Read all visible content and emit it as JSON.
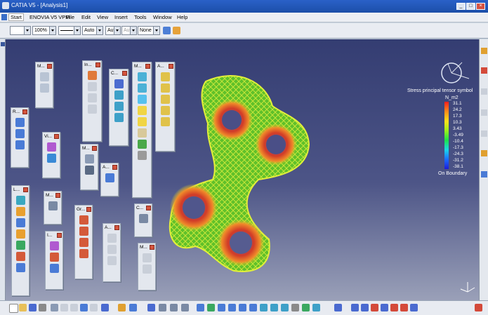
{
  "window": {
    "title": "CATIA V5 - [Analysis1]",
    "buttons": [
      "_",
      "□",
      "×"
    ]
  },
  "menu": [
    "Start",
    "ENOVIA V5 VPM",
    "File",
    "Edit",
    "View",
    "Insert",
    "Tools",
    "Window",
    "Help"
  ],
  "props": {
    "zoom": "100%",
    "lineauto": "Auto",
    "aut1": "Aut",
    "aut2": "Aut",
    "none": "None"
  },
  "palettes": [
    {
      "id": "p1",
      "title": "M..."
    },
    {
      "id": "p2",
      "title": "In..."
    },
    {
      "id": "p3",
      "title": "C..."
    },
    {
      "id": "p4",
      "title": "M..."
    },
    {
      "id": "p5",
      "title": "A..."
    },
    {
      "id": "p6",
      "title": "R..."
    },
    {
      "id": "p7",
      "title": "Vi..."
    },
    {
      "id": "p8",
      "title": "M..."
    },
    {
      "id": "p9",
      "title": "A..."
    },
    {
      "id": "p10",
      "title": "L..."
    },
    {
      "id": "p11",
      "title": "M..."
    },
    {
      "id": "p12",
      "title": "Gr..."
    },
    {
      "id": "p13",
      "title": "C..."
    },
    {
      "id": "p14",
      "title": "I..."
    },
    {
      "id": "p15",
      "title": "A..."
    },
    {
      "id": "p16",
      "title": "M..."
    }
  ],
  "legend": {
    "title": "Stress principal tensor symbol",
    "unit": "N_m2",
    "values": [
      "31.1",
      "24.2",
      "17.3",
      "10.3",
      "3.43",
      "-3.49",
      "-10.4",
      "-17.3",
      "-24.3",
      "-31.2",
      "-38.1"
    ],
    "footer": "On Boundary",
    "colors": [
      "#ff1e1e",
      "#ff8c1a",
      "#ffe11a",
      "#9cf01a",
      "#1ce34a",
      "#1ad6e8",
      "#1a6cff",
      "#1d1bd6"
    ]
  }
}
